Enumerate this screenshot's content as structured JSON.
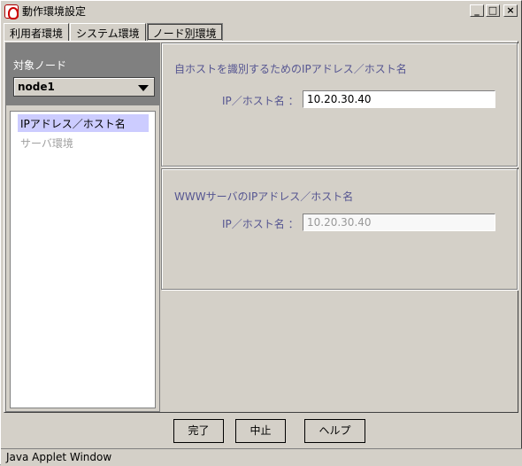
{
  "window": {
    "title": "動作環境設定",
    "controls": {
      "minimize": "_",
      "maximize": "□",
      "close": "×"
    }
  },
  "tabs": [
    {
      "label": "利用者環境",
      "active": false
    },
    {
      "label": "システム環境",
      "active": false
    },
    {
      "label": "ノード別環境",
      "active": true
    }
  ],
  "sidebar": {
    "node_label": "対象ノード",
    "node_selected": "node1",
    "items": [
      {
        "label": "IPアドレス／ホスト名",
        "selected": true,
        "enabled": true
      },
      {
        "label": "サーバ環境",
        "selected": false,
        "enabled": false
      }
    ]
  },
  "panels": {
    "self_host": {
      "title": "自ホストを識別するためのIPアドレス／ホスト名",
      "field_label": "IP／ホスト名 ：",
      "field_value": "10.20.30.40"
    },
    "www_server": {
      "title": "WWWサーバのIPアドレス／ホスト名",
      "field_label": "IP／ホスト名 ：",
      "field_value": "10.20.30.40"
    }
  },
  "buttons": {
    "ok": "完了",
    "cancel": "中止",
    "help": "ヘルプ"
  },
  "status": "Java Applet Window",
  "colors": {
    "background": "#d4d0c8",
    "label_text": "#555591",
    "selected_item": "#ccccff",
    "header_gray": "#808080"
  }
}
